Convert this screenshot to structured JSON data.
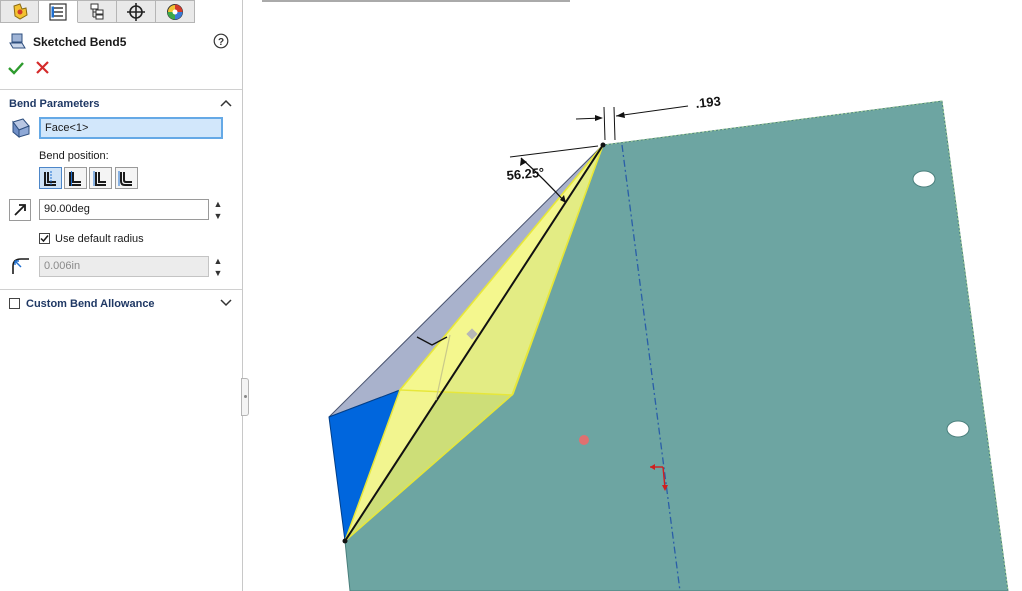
{
  "panel": {
    "tabs": [
      {
        "icon": "feature-manager-icon"
      },
      {
        "icon": "property-manager-icon",
        "active": true
      },
      {
        "icon": "configuration-manager-icon"
      },
      {
        "icon": "dimxpert-icon"
      },
      {
        "icon": "display-manager-icon"
      }
    ],
    "title": "Sketched Bend5",
    "help_icon": "help-icon",
    "ok_icon": "checkmark-icon",
    "cancel_icon": "close-icon",
    "bend_parameters": {
      "label": "Bend Parameters",
      "face_value": "Face<1>",
      "bend_position_label": "Bend position:",
      "positions": [
        "bend-centerline",
        "material-inside",
        "material-outside",
        "bend-outside"
      ],
      "angle_value": "90.00deg",
      "use_default_radius_label": "Use default radius",
      "use_default_radius_checked": true,
      "radius_value": "0.006in"
    },
    "custom_bend_allowance": {
      "label": "Custom Bend Allowance",
      "checked": false
    }
  },
  "viewport": {
    "dim_distance": ".193",
    "dim_angle": "56.25°"
  },
  "colors": {
    "sheet": "#6da5a2",
    "sheet_edge": "#4a7f7c",
    "flange_top": "#a9b2cc",
    "flange_side": "#0066dd",
    "preview": "#eef26a",
    "preview_edge": "#e7e73a",
    "accent": "#1e6fd0"
  }
}
